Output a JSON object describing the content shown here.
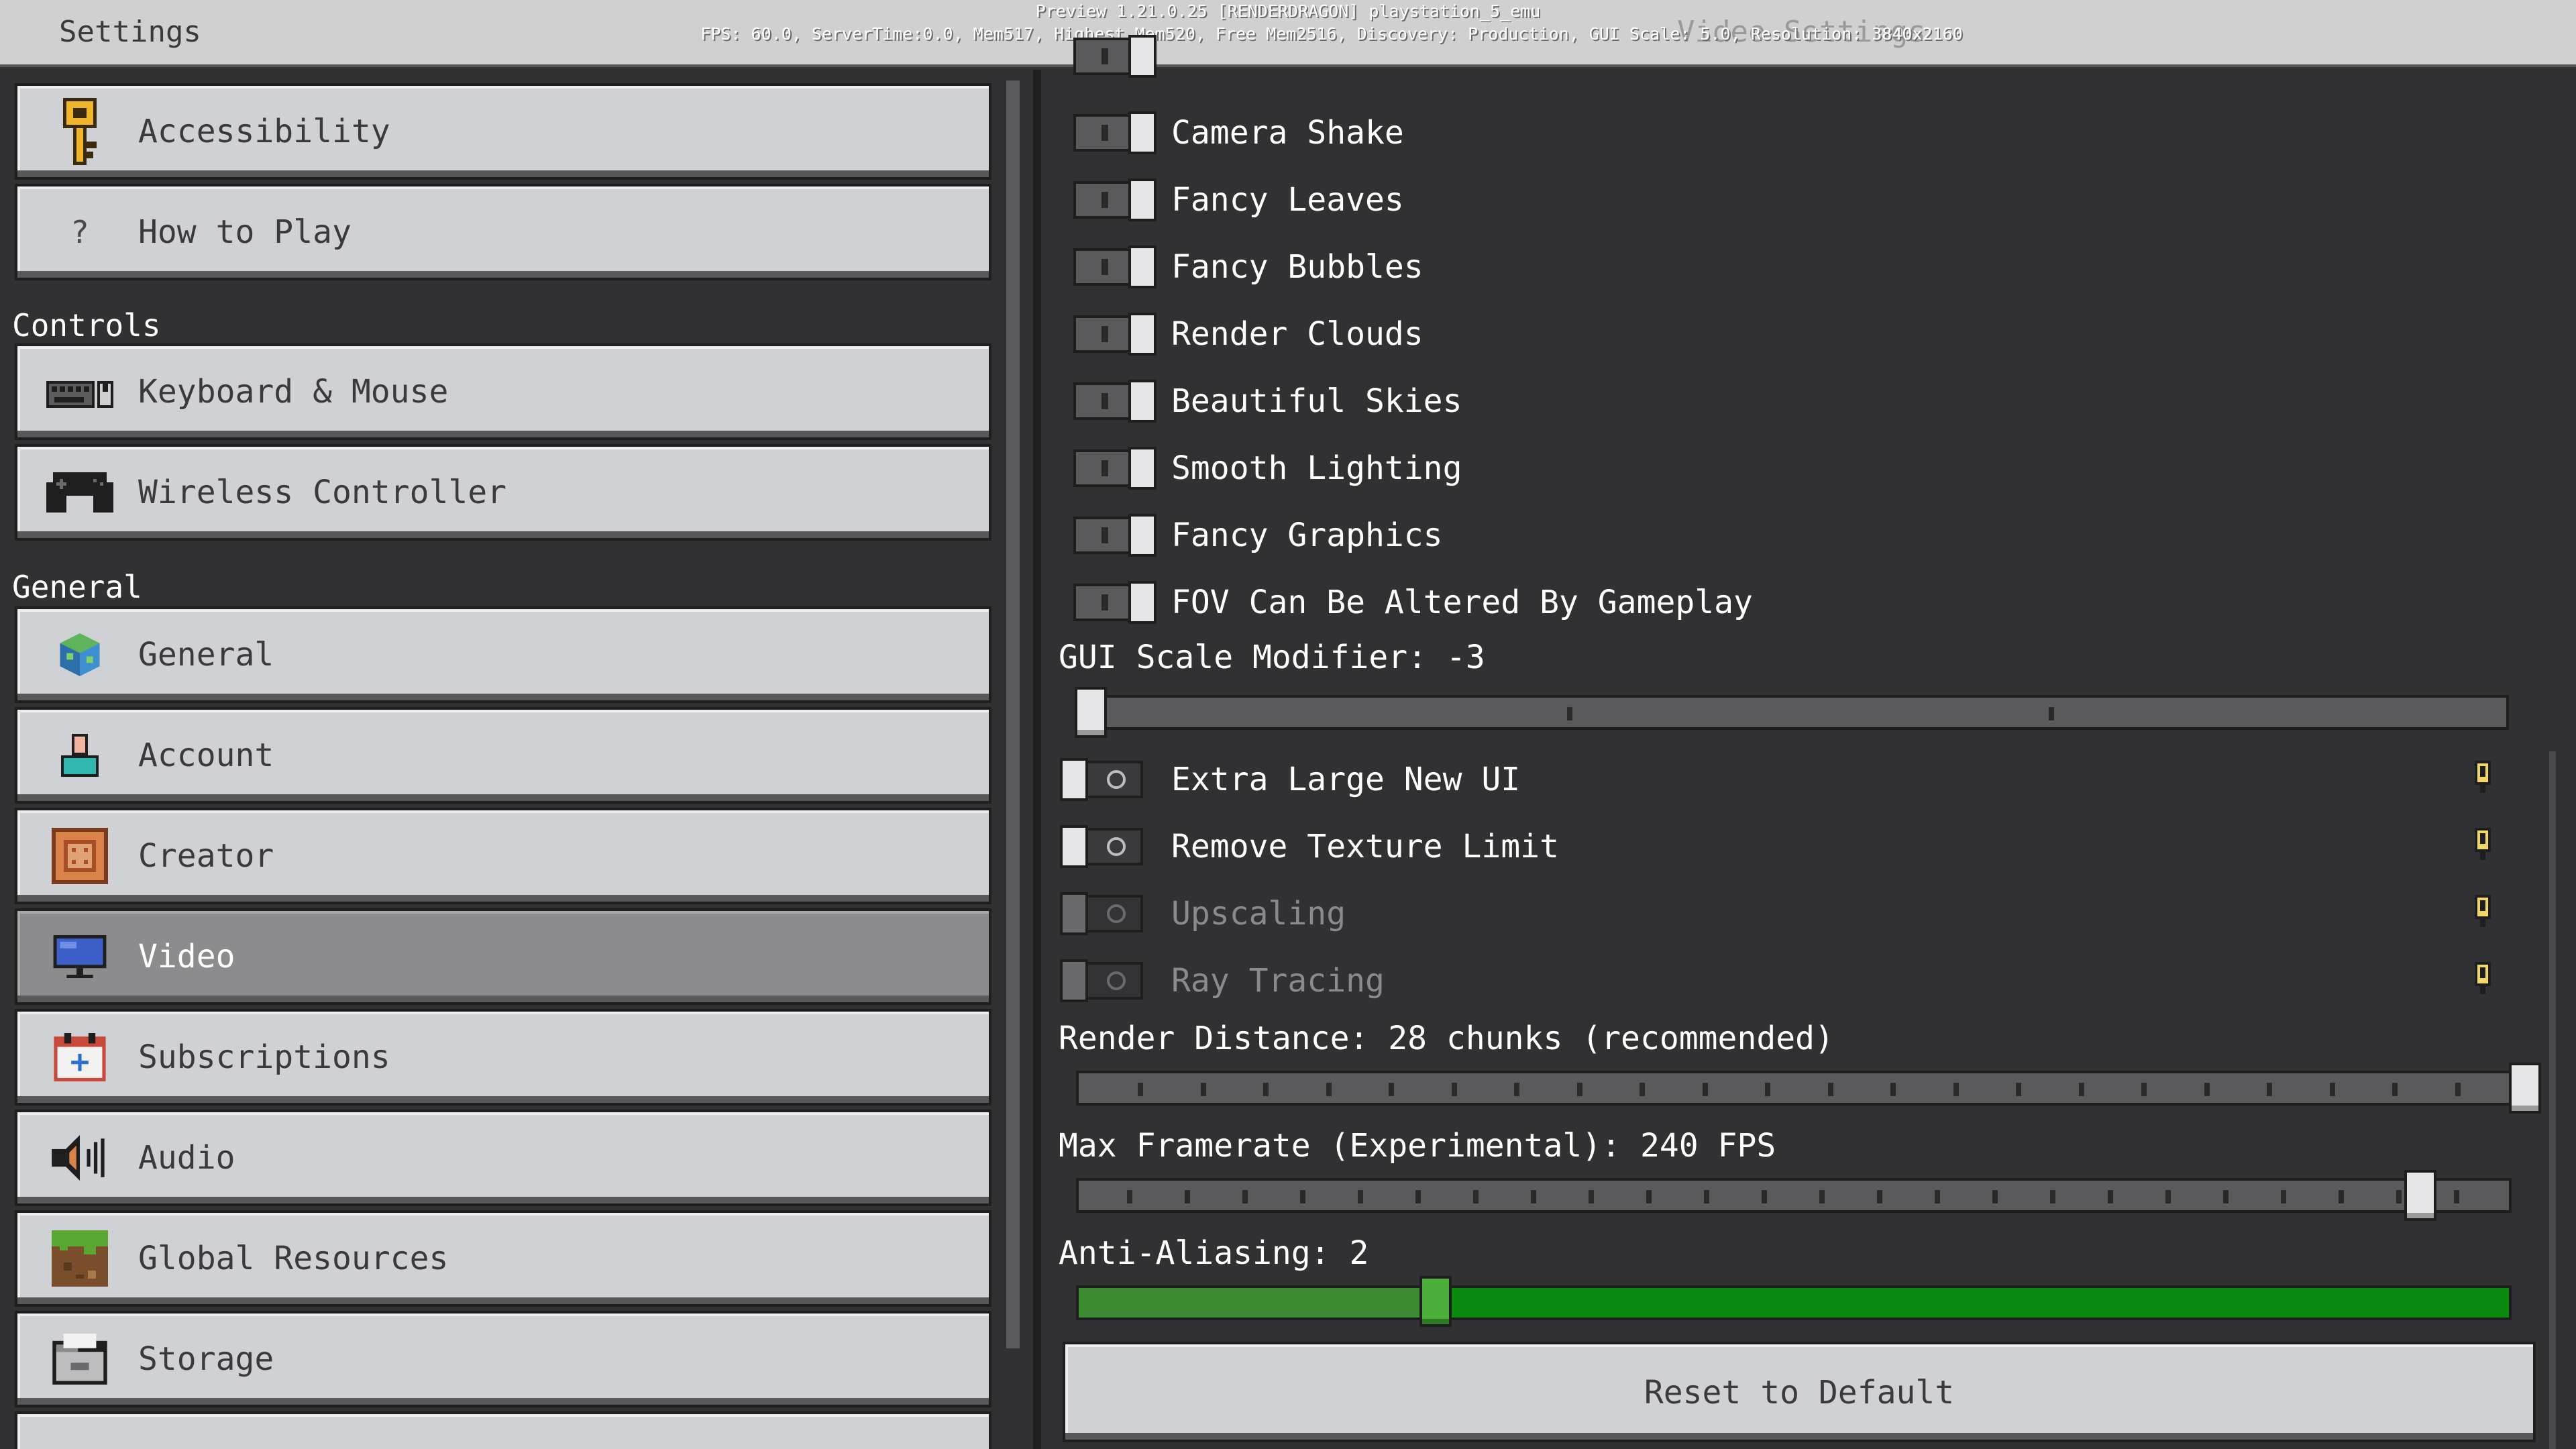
{
  "titlebar": {
    "title": "Settings",
    "ghost_title": "Video Settings",
    "debug_line1": "Preview 1.21.0.25 [RENDERDRAGON]  playstation_5_emu",
    "debug_line2": "FPS: 60.0, ServerTime:0.0, Mem517, Highest Mem520, Free Mem2516, Discovery: Production, GUI Scale: 5.0, Resolution: 3840x2160"
  },
  "sidebar": {
    "items_top": [
      {
        "label": "Accessibility",
        "icon": "key-icon"
      },
      {
        "label": "How to Play",
        "icon": "question-icon",
        "glyph": "?"
      }
    ],
    "controls_header": "Controls",
    "controls": [
      {
        "label": "Keyboard & Mouse",
        "icon": "keyboard-mouse-icon"
      },
      {
        "label": "Wireless Controller",
        "icon": "gamepad-icon"
      }
    ],
    "general_header": "General",
    "general": [
      {
        "label": "General",
        "icon": "cube-icon"
      },
      {
        "label": "Account",
        "icon": "account-icon"
      },
      {
        "label": "Creator",
        "icon": "creator-icon"
      },
      {
        "label": "Video",
        "icon": "monitor-icon",
        "selected": true
      },
      {
        "label": "Subscriptions",
        "icon": "calendar-plus-icon"
      },
      {
        "label": "Audio",
        "icon": "speaker-icon"
      },
      {
        "label": "Global Resources",
        "icon": "grass-block-icon"
      },
      {
        "label": "Storage",
        "icon": "folder-icon"
      }
    ]
  },
  "video": {
    "toggles_on": [
      {
        "label": "Camera Shake"
      },
      {
        "label": "Fancy Leaves"
      },
      {
        "label": "Fancy Bubbles"
      },
      {
        "label": "Render Clouds"
      },
      {
        "label": "Beautiful Skies"
      },
      {
        "label": "Smooth Lighting"
      },
      {
        "label": "Fancy Graphics"
      },
      {
        "label": "FOV Can Be Altered By Gameplay"
      }
    ],
    "gui_scale": {
      "label": "GUI Scale Modifier: -3",
      "value": -3,
      "min": -3,
      "max": 0
    },
    "toggles_off": [
      {
        "label": "Extra Large New UI",
        "disabled": false
      },
      {
        "label": "Remove Texture Limit",
        "disabled": false
      },
      {
        "label": "Upscaling",
        "disabled": true
      },
      {
        "label": "Ray Tracing",
        "disabled": true
      }
    ],
    "render_distance": {
      "label": "Render Distance: 28 chunks (recommended)",
      "value": 28
    },
    "max_framerate": {
      "label": "Max Framerate (Experimental): 240 FPS",
      "value": 240
    },
    "anti_aliasing": {
      "label": "Anti-Aliasing: 2",
      "value": 2
    },
    "reset_label": "Reset to Default"
  },
  "colors": {
    "panel_bg": "#313133",
    "button_bg": "#d0d1d4",
    "selected_bg": "#8c8b8d",
    "accent_green": "#0a8a10"
  }
}
